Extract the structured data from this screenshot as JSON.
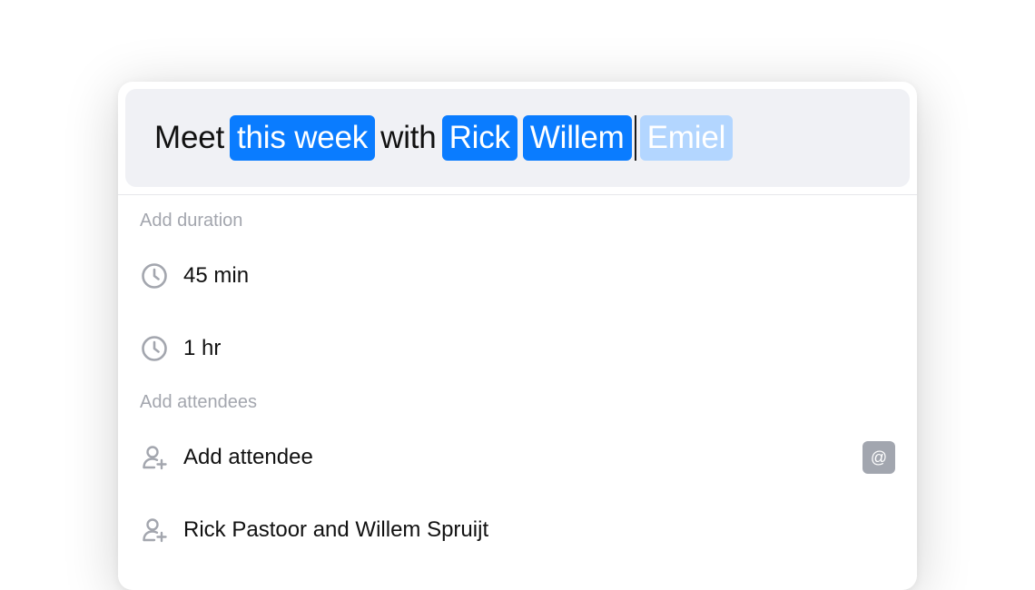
{
  "query": {
    "word_meet": "Meet",
    "chip_when": "this week",
    "word_with": "with",
    "chip_person_1": "Rick",
    "chip_person_2": "Willem",
    "chip_tentative": "Emiel"
  },
  "duration_section": {
    "heading": "Add duration",
    "options": [
      {
        "label": "45 min",
        "icon": "clock-icon"
      },
      {
        "label": "1 hr",
        "icon": "clock-icon"
      }
    ]
  },
  "attendees_section": {
    "heading": "Add attendees",
    "options": [
      {
        "label": "Add attendee",
        "icon": "add-user-icon",
        "shortcut": "@"
      },
      {
        "label": "Rick Pastoor and Willem Spruijt",
        "icon": "add-user-icon"
      }
    ]
  },
  "colors": {
    "accent": "#0a7cff",
    "tentative_chip": "#b3d6ff",
    "muted_text": "#a3a6ae",
    "query_background": "#f0f1f5",
    "shortcut_badge": "#a2a6af"
  }
}
